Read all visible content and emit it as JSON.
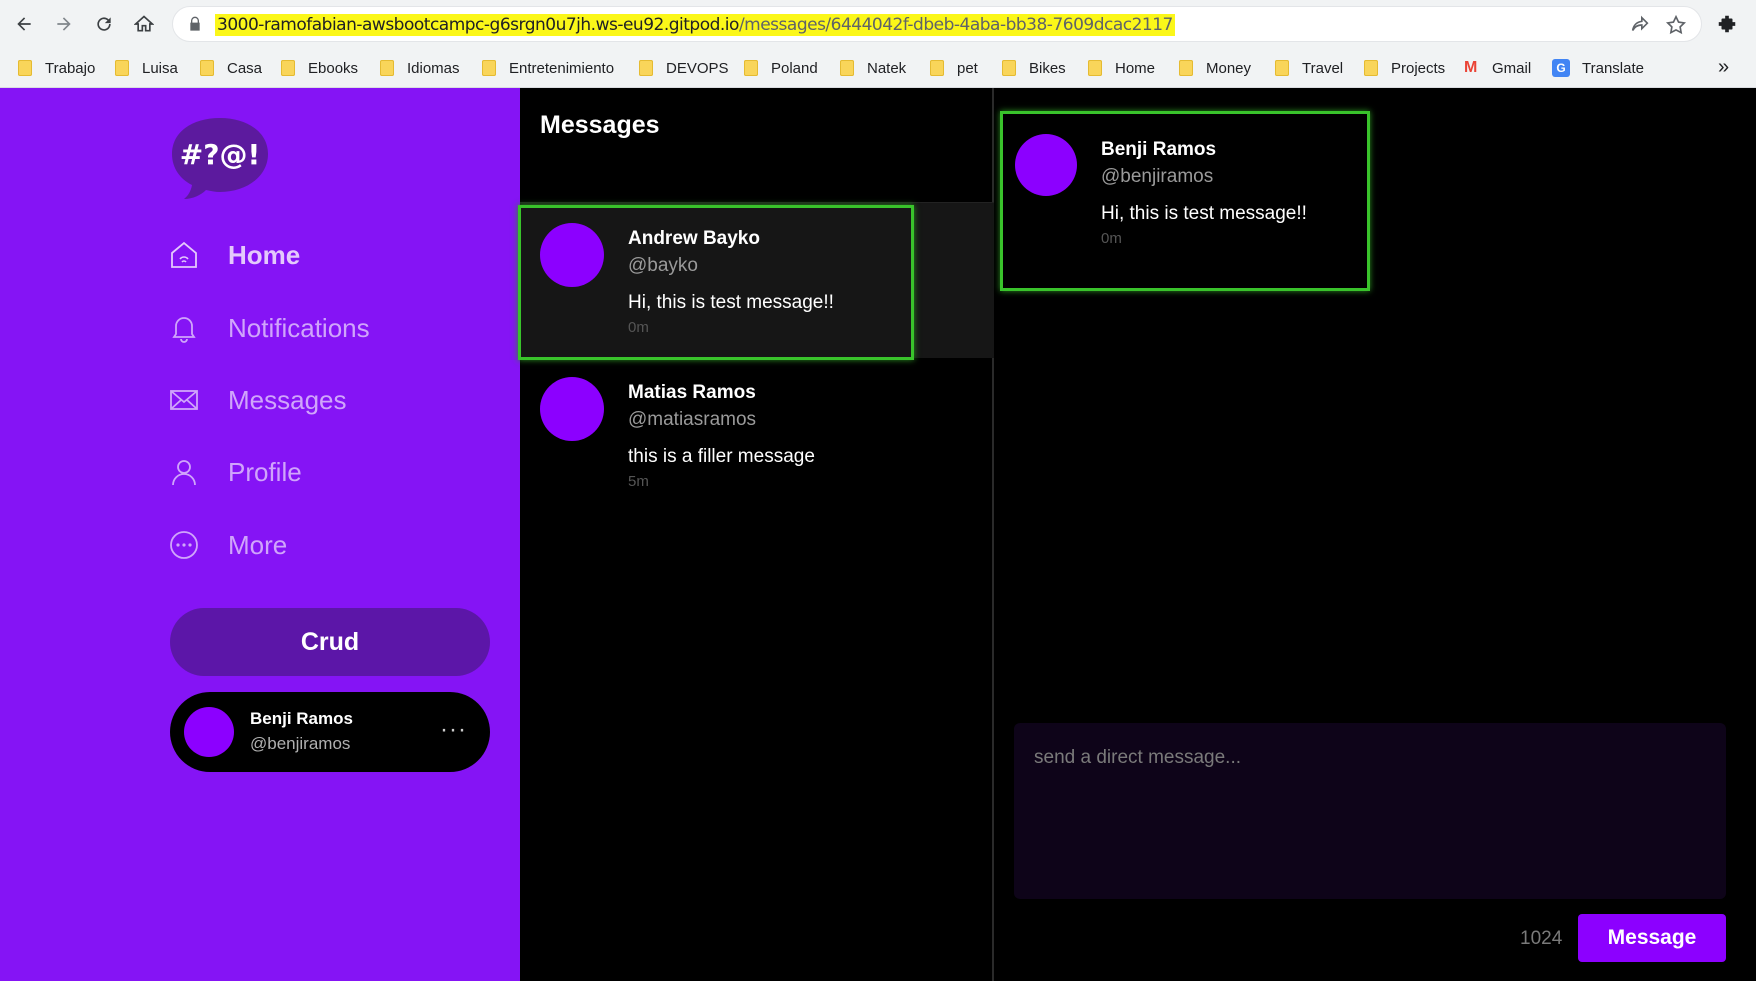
{
  "browser": {
    "url_host": "3000-ramofabian-awsbootcampc-g6srgn0u7jh.ws-eu92.gitpod.io",
    "url_path": "/messages/6444042f-dbeb-4aba-bb38-7609dcac2117",
    "bookmarks": [
      "Trabajo",
      "Luisa",
      "Casa",
      "Ebooks",
      "Idiomas",
      "Entretenimiento",
      "DEVOPS",
      "Poland",
      "Natek",
      "pet",
      "Bikes",
      "Home",
      "Money",
      "Travel",
      "Projects",
      "Gmail",
      "Translate"
    ],
    "bookmarks_more": "»"
  },
  "sidebar": {
    "logo_text": "#?@!",
    "nav": [
      {
        "label": "Home",
        "icon": "home-icon",
        "active": true
      },
      {
        "label": "Notifications",
        "icon": "bell-icon"
      },
      {
        "label": "Messages",
        "icon": "mail-icon"
      },
      {
        "label": "Profile",
        "icon": "user-icon"
      },
      {
        "label": "More",
        "icon": "more-circle-icon"
      }
    ],
    "crud_label": "Crud",
    "profile": {
      "name": "Benji Ramos",
      "handle": "@benjiramos",
      "menu": "···"
    }
  },
  "message_groups": {
    "title": "Messages",
    "items": [
      {
        "name": "Andrew Bayko",
        "handle": "@bayko",
        "message": "Hi, this is test message!!",
        "time": "0m",
        "selected": true
      },
      {
        "name": "Matias Ramos",
        "handle": "@matiasramos",
        "message": "this is a filler message",
        "time": "5m"
      }
    ]
  },
  "conversation": {
    "messages": [
      {
        "name": "Benji Ramos",
        "handle": "@benjiramos",
        "message": "Hi, this is test message!!",
        "time": "0m"
      }
    ],
    "compose_placeholder": "send a direct message...",
    "char_count": "1024",
    "send_label": "Message"
  },
  "colors": {
    "sidebar_bg": "#8514f5",
    "avatar": "#8c00ff",
    "highlight_border": "#39c32b",
    "url_highlight": "#fbf719"
  }
}
